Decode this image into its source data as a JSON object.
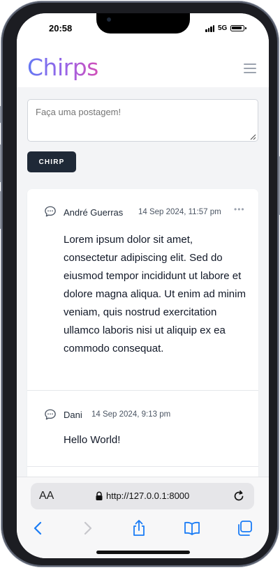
{
  "status_bar": {
    "time": "20:58",
    "network": "5G"
  },
  "header": {
    "app_name": "Chirps"
  },
  "composer": {
    "placeholder": "Faça uma postagem!",
    "submit_label": "CHIRP"
  },
  "chirps": [
    {
      "author": "André Guerras",
      "date": "14 Sep 2024, 11:57 pm",
      "message": "Lorem ipsum dolor sit amet, consectetur adipiscing elit. Sed do eiusmod tempor incididunt ut labore et dolore magna aliqua. Ut enim ad minim veniam, quis nostrud exercitation ullamco laboris nisi ut aliquip ex ea commodo consequat."
    },
    {
      "author": "Dani",
      "date": "14 Sep 2024, 9:13 pm",
      "message": "Hello World!"
    }
  ],
  "browser": {
    "text_size_label": "AA",
    "url": "http://127.0.0.1:8000"
  },
  "colors": {
    "accent_start": "#6478f3",
    "accent_end": "#d24fb8",
    "button_bg": "#1f2937",
    "safari_blue": "#1a7cf5"
  },
  "icons": [
    "chat-bubble-icon",
    "more-dots-icon",
    "hamburger-menu-icon",
    "lock-icon",
    "reload-icon",
    "back-icon",
    "forward-icon",
    "share-icon",
    "bookmarks-icon",
    "tabs-icon"
  ]
}
